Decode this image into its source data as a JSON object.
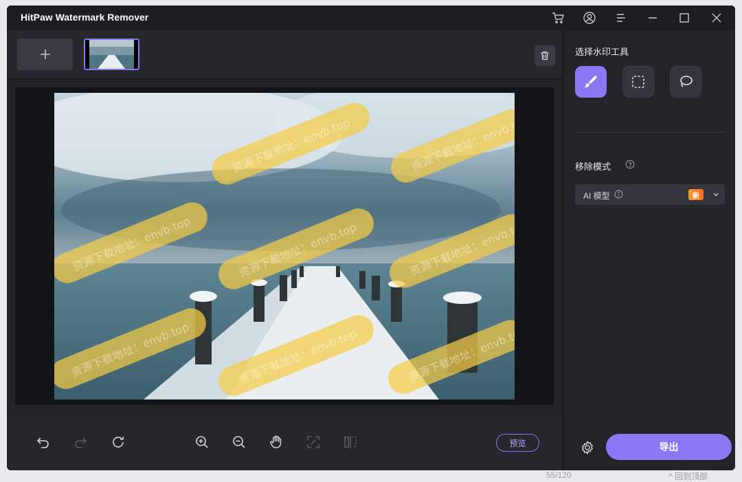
{
  "app": {
    "title": "HitPaw Watermark Remover"
  },
  "header": {
    "icons": [
      "cart-icon",
      "account-icon",
      "menu-icon",
      "minimize-icon",
      "maximize-icon",
      "close-icon"
    ]
  },
  "thumbnails": {
    "add_label": "+"
  },
  "right_panel": {
    "tool_section_title": "选择水印工具",
    "tools": [
      {
        "name": "brush-tool",
        "icon": "brush-icon",
        "active": true
      },
      {
        "name": "rectangle-select-tool",
        "icon": "rect-select-icon",
        "active": false
      },
      {
        "name": "lasso-tool",
        "icon": "lasso-icon",
        "active": false
      }
    ],
    "mode_title": "移除模式",
    "mode_select": {
      "value": "AI 模型",
      "badge": "新"
    },
    "export_label": "导出"
  },
  "bottom_bar": {
    "preview_label": "预览"
  },
  "watermark": {
    "text": "资源下载地址：envb.top"
  },
  "colors": {
    "accent": "#8a78f2",
    "badge": "#ff7a22",
    "mask": "#f5cc46",
    "bg_dark": "#1a1b20"
  },
  "footer_outside": {
    "page_count": "55/120",
    "back_top": "^ 回到顶部"
  }
}
